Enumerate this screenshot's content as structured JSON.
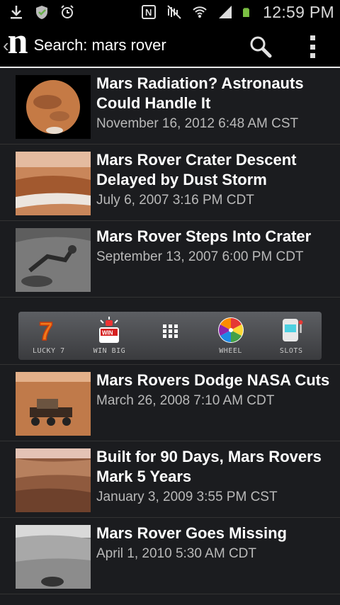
{
  "status_bar": {
    "time": "12:59 PM",
    "icons": [
      "download-icon",
      "shield-icon",
      "alarm-icon",
      "nfc-icon",
      "mute-icon",
      "wifi-icon",
      "signal-icon",
      "battery-icon"
    ]
  },
  "action_bar": {
    "logo": "n",
    "title": "Search: mars rover",
    "icons": [
      "up-caret-icon",
      "search-icon",
      "overflow-menu-icon"
    ]
  },
  "articles_top": [
    {
      "headline": "Mars Radiation? Astronauts Could Handle It",
      "date": "November 16, 2012 6:48 AM CST",
      "thumb": "mars-planet"
    },
    {
      "headline": "Mars Rover Crater Descent Delayed by Dust Storm",
      "date": "July 6, 2007 3:16 PM CDT",
      "thumb": "crater-rim"
    },
    {
      "headline": "Mars Rover Steps Into Crater",
      "date": "September 13, 2007 6:00 PM CDT",
      "thumb": "rover-arm"
    }
  ],
  "ad_bar": {
    "items": [
      {
        "label": "LUCKY 7",
        "icon": "lucky-seven-icon"
      },
      {
        "label": "WIN BIG",
        "icon": "win-big-icon",
        "badge": "WIN"
      },
      {
        "label": "",
        "icon": "grid-icon"
      },
      {
        "label": "WHEEL",
        "icon": "wheel-icon"
      },
      {
        "label": "SLOTS",
        "icon": "slots-icon"
      }
    ]
  },
  "articles_bottom": [
    {
      "headline": "Mars Rovers Dodge NASA Cuts",
      "date": "March 26, 2008 7:10 AM CDT",
      "thumb": "rover-desert"
    },
    {
      "headline": "Built for 90 Days, Mars Rovers Mark 5 Years",
      "date": "January 3, 2009 3:55 PM CST",
      "thumb": "mars-landscape"
    },
    {
      "headline": "Mars Rover Goes Missing",
      "date": "April 1, 2010 5:30 AM CDT",
      "thumb": "grey-terrain"
    }
  ],
  "colors": {
    "background": "#1b1c1f",
    "bar": "#000000",
    "date_text": "#b9b9b9",
    "divider": "#333333"
  }
}
